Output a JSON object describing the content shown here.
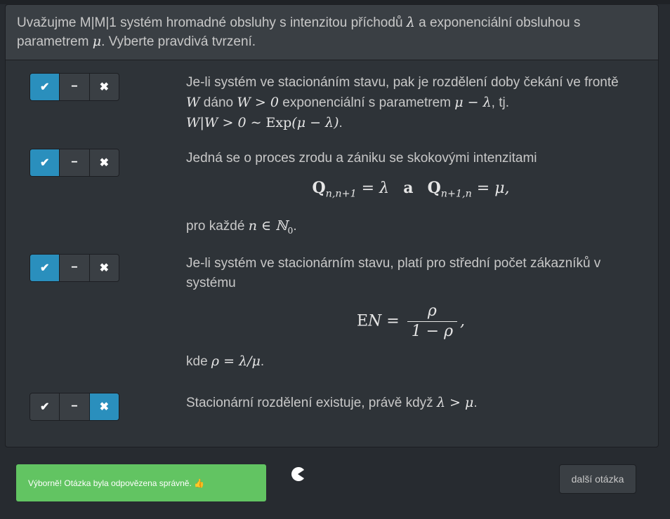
{
  "question": {
    "text_a": "Uvažujme M|M|1 systém hromadné obsluhy s intenzitou příchodů ",
    "sym_lambda": "λ",
    "text_b": " a exponenciální obsluhou s parametrem ",
    "sym_mu": "μ",
    "text_c": ". Vyberte pravdivá tvrzení."
  },
  "buttons": {
    "true_glyph": "✔",
    "neutral_glyph": "−",
    "false_glyph": "✖"
  },
  "statements": [
    {
      "selected": "true",
      "t1": "Je-li systém ve stacionáním stavu, pak je rozdělení doby čekání ve frontě ",
      "m1": "W",
      "t2": " dáno ",
      "m2": "W > 0",
      "t3": " exponenciální s parametrem ",
      "m3": "μ − λ",
      "t4": ", tj.",
      "m4a": "W|W > 0 ∼ ",
      "m4b": "Exp",
      "m4c": "(μ − λ)",
      "t5": "."
    },
    {
      "selected": "true",
      "t1": "Jedná se o proces zrodu a zániku se skokovými intenzitami",
      "d_q": "Q",
      "d_sub1": "n,n+1",
      "d_eq1": " = λ",
      "d_a": "a",
      "d_sub2": "n+1,n",
      "d_eq2": " = μ,",
      "t2": "pro každé ",
      "m2": "n ∈ ℕ",
      "m2sub": "0",
      "t3": "."
    },
    {
      "selected": "true",
      "t1": "Je-li systém ve stacionárním stavu, platí pro střední počet zákazníků v systému",
      "d_e": "E",
      "d_n": "N = ",
      "d_num": "ρ",
      "d_den": "1 − ρ",
      "d_comma": ",",
      "t2": "kde ",
      "m2": "ρ = λ/μ",
      "t3": "."
    },
    {
      "selected": "false",
      "t1": "Stacionární rozdělení existuje, právě když ",
      "m1": "λ > μ",
      "t2": "."
    }
  ],
  "feedback": {
    "message": "Výborně! Otázka byla odpovězena správně. 👍"
  },
  "next_button": {
    "label": "další otázka"
  },
  "colors": {
    "accent": "#2a8fbd",
    "success": "#62c462",
    "background": "#272b30"
  }
}
